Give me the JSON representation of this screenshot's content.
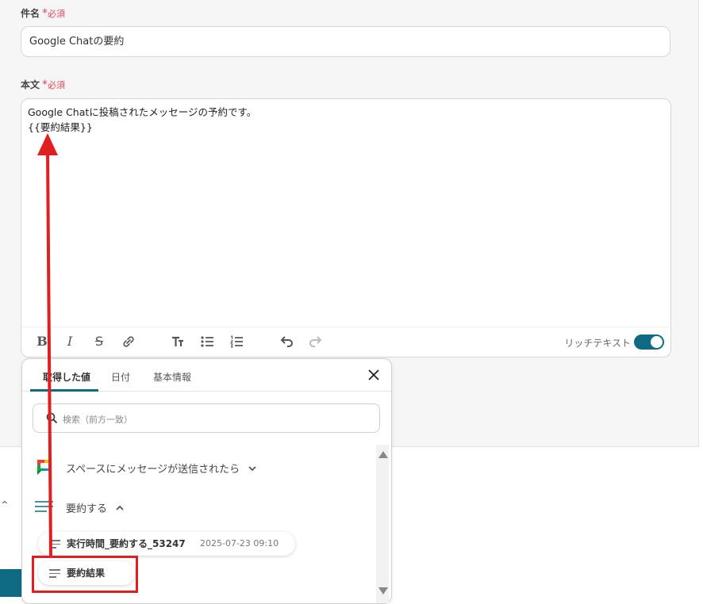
{
  "subject": {
    "label": "件名",
    "required": "必須",
    "value": "Google Chatの要約"
  },
  "body": {
    "label": "本文",
    "required": "必須",
    "line1": "Google Chatに投稿されたメッセージの予約です。",
    "line2": "{{要約結果}}"
  },
  "toolbar": {
    "rich_text_label": "リッチテキスト",
    "rich_text_enabled": true
  },
  "popup": {
    "tabs": [
      "取得した値",
      "日付",
      "基本情報"
    ],
    "active_tab": 0,
    "search_placeholder": "検索（前方一致）",
    "sections": [
      {
        "label": "スペースにメッセージが送信されたら",
        "expanded": false
      },
      {
        "label": "要約する",
        "expanded": true
      }
    ],
    "items": [
      {
        "label": "実行時間_要約する_53247",
        "value": "2025-07-23 09:10"
      },
      {
        "label": "要約結果",
        "value": ""
      }
    ]
  },
  "colors": {
    "accent": "#0f6a84",
    "required": "#e0475b",
    "annotation": "#e02020"
  }
}
